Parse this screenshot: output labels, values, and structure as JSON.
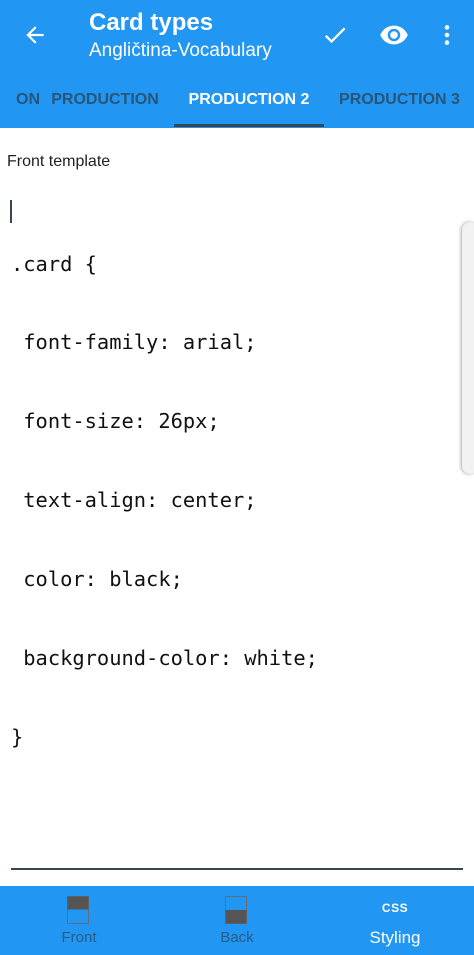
{
  "appbar": {
    "title": "Card types",
    "subtitle": "Angličtina-Vocabulary",
    "back_icon": "arrow-left",
    "confirm_icon": "check",
    "preview_icon": "eye",
    "more_icon": "more-vertical"
  },
  "tabs": [
    {
      "label": "ON",
      "active": false
    },
    {
      "label": "PRODUCTION",
      "active": false
    },
    {
      "label": "PRODUCTION 2",
      "active": true
    },
    {
      "label": "PRODUCTION 3",
      "active": false
    }
  ],
  "editor": {
    "section_label": "Front template",
    "lines": [
      ".card {",
      " font-family: arial;",
      " font-size: 26px;",
      " text-align: center;",
      " color: black;",
      " background-color: white;",
      "}"
    ]
  },
  "bottom_nav": {
    "items": [
      {
        "label": "Front",
        "active": false,
        "icon": "front-template-icon"
      },
      {
        "label": "Back",
        "active": false,
        "icon": "back-template-icon"
      },
      {
        "label": "Styling",
        "active": true,
        "icon_text": "CSS"
      }
    ]
  },
  "colors": {
    "primary": "#2196f3",
    "indicator": "#37474f",
    "inactive_text": "#2d2d2d",
    "active_text": "#ffffff"
  }
}
